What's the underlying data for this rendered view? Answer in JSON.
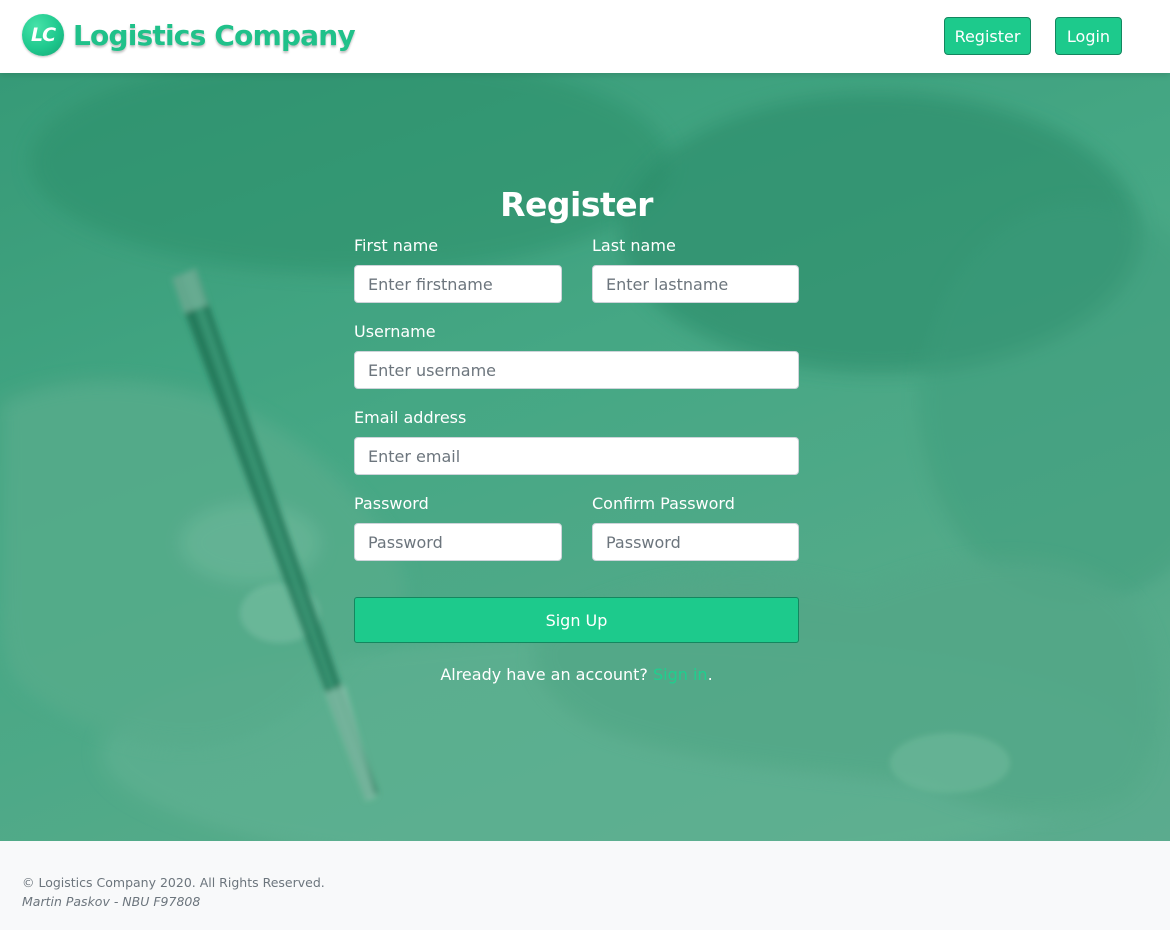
{
  "header": {
    "logo_text": "LC",
    "brand_name": "Logistics Company",
    "nav": {
      "register_label": "Register",
      "login_label": "Login"
    }
  },
  "form": {
    "title": "Register",
    "first_name": {
      "label": "First name",
      "placeholder": "Enter firstname"
    },
    "last_name": {
      "label": "Last name",
      "placeholder": "Enter lastname"
    },
    "username": {
      "label": "Username",
      "placeholder": "Enter username"
    },
    "email": {
      "label": "Email address",
      "placeholder": "Enter email"
    },
    "password": {
      "label": "Password",
      "placeholder": "Password"
    },
    "confirm_password": {
      "label": "Confirm Password",
      "placeholder": "Password"
    },
    "submit_label": "Sign Up",
    "signin_prompt": "Already have an account?",
    "signin_link": "Sign in",
    "signin_suffix": "."
  },
  "footer": {
    "copyright": "© Logistics Company 2020. All Rights Reserved.",
    "author": "Martin Paskov - NBU F97808"
  },
  "colors": {
    "accent": "#1dca8c",
    "accent_border": "#13875f",
    "hero_tint": "#4aa987",
    "footer_bg": "#f8f9fa"
  }
}
